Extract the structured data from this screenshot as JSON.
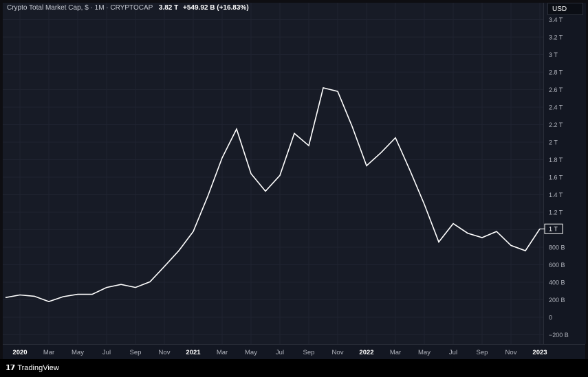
{
  "header": {
    "symbol": "Crypto Total Market Cap, $ · 1M · CRYPTOCAP",
    "last_value": "3.82 T",
    "change": "+549.92 B (+16.83%)"
  },
  "currency_button": "USD",
  "brand": "TradingView",
  "price_tag": "1 T",
  "colors": {
    "line": "#ffffff",
    "background": "#171b26",
    "axis_text": "#b2b5be",
    "grid": "#1f2330"
  },
  "chart_data": {
    "type": "line",
    "title": "Crypto Total Market Cap, $ · 1M · CRYPTOCAP",
    "xlabel": "",
    "ylabel": "",
    "ylim": [
      -250000000000,
      3450000000000
    ],
    "grid": true,
    "x_tick_labels": [
      "2020",
      "Mar",
      "May",
      "Jul",
      "Sep",
      "Nov",
      "2021",
      "Mar",
      "May",
      "Jul",
      "Sep",
      "Nov",
      "2022",
      "Mar",
      "May",
      "Jul",
      "Sep",
      "Nov",
      "2023"
    ],
    "x_tick_bold": [
      "2020",
      "2021",
      "2022",
      "2023"
    ],
    "y_tick_labels": [
      "3.4 T",
      "3.2 T",
      "3 T",
      "2.8 T",
      "2.6 T",
      "2.4 T",
      "2.2 T",
      "2 T",
      "1.8 T",
      "1.6 T",
      "1.4 T",
      "1.2 T",
      "1 T",
      "800 B",
      "600 B",
      "400 B",
      "200 B",
      "0",
      "−200 B"
    ],
    "y_tick_values": [
      3400000000000,
      3200000000000,
      3000000000000,
      2800000000000,
      2600000000000,
      2400000000000,
      2200000000000,
      2000000000000,
      1800000000000,
      1600000000000,
      1400000000000,
      1200000000000,
      1000000000000,
      800000000000,
      600000000000,
      400000000000,
      200000000000,
      0,
      -200000000000
    ],
    "series": [
      {
        "x": [
          "2019-12",
          "2020-01",
          "2020-02",
          "2020-03",
          "2020-04",
          "2020-05",
          "2020-06",
          "2020-07",
          "2020-08",
          "2020-09",
          "2020-10",
          "2020-11",
          "2020-12",
          "2021-01",
          "2021-02",
          "2021-03",
          "2021-04",
          "2021-05",
          "2021-06",
          "2021-07",
          "2021-08",
          "2021-09",
          "2021-10",
          "2021-11",
          "2021-12",
          "2022-01",
          "2022-02",
          "2022-03",
          "2022-04",
          "2022-05",
          "2022-06",
          "2022-07",
          "2022-08",
          "2022-09",
          "2022-10",
          "2022-11",
          "2022-12",
          "2023-01"
        ],
        "values": [
          225000000000,
          255000000000,
          240000000000,
          180000000000,
          235000000000,
          262000000000,
          262000000000,
          340000000000,
          375000000000,
          340000000000,
          405000000000,
          580000000000,
          760000000000,
          980000000000,
          1380000000000,
          1820000000000,
          2150000000000,
          1640000000000,
          1440000000000,
          1620000000000,
          2100000000000,
          1960000000000,
          2620000000000,
          2580000000000,
          2180000000000,
          1730000000000,
          1880000000000,
          2050000000000,
          1680000000000,
          1290000000000,
          860000000000,
          1070000000000,
          960000000000,
          910000000000,
          980000000000,
          820000000000,
          760000000000,
          1010000000000
        ]
      }
    ]
  }
}
